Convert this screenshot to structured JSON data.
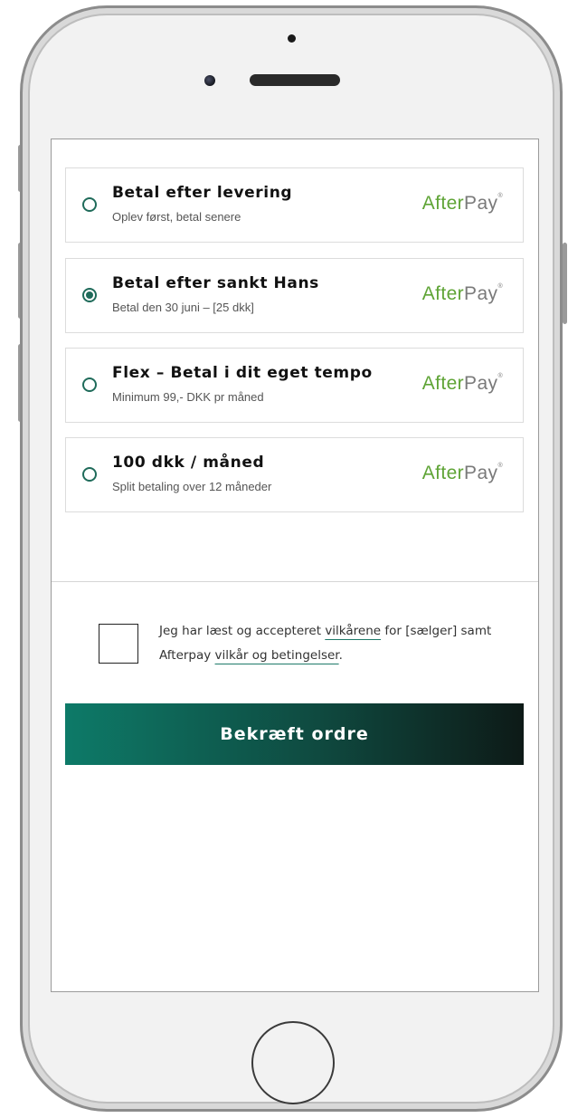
{
  "options": [
    {
      "title": "Betal efter levering",
      "subtitle": "Oplev først, betal senere",
      "selected": false,
      "logo": {
        "part1": "After",
        "part2": "Pay",
        "mark": "®"
      }
    },
    {
      "title": "Betal efter sankt Hans",
      "subtitle": "Betal den 30 juni – [25 dkk]",
      "selected": true,
      "logo": {
        "part1": "After",
        "part2": "Pay",
        "mark": "®"
      }
    },
    {
      "title": "Flex – Betal i dit eget tempo",
      "subtitle": "Minimum 99,- DKK pr måned",
      "selected": false,
      "logo": {
        "part1": "After",
        "part2": "Pay",
        "mark": "®"
      }
    },
    {
      "title": "100 dkk / måned",
      "subtitle": "Split betaling over 12 måneder",
      "selected": false,
      "logo": {
        "part1": "After",
        "part2": "Pay",
        "mark": "®"
      }
    }
  ],
  "terms": {
    "text1": "Jeg har læst og accepteret ",
    "link1": "vilkårene",
    "text2": " for [sælger] samt Afterpay ",
    "link2": "vilkår og betingelser",
    "text3": ".",
    "checked": false
  },
  "confirm_label": "Bekræft ordre",
  "colors": {
    "accent": "#1f6b5a",
    "logo_green": "#5fa436",
    "logo_gray": "#7a7a7a",
    "button_start": "#0d7a68",
    "button_end": "#0d1a17"
  },
  "icons": {
    "radio_unselected": "radio-empty-circle",
    "radio_selected": "radio-filled-circle",
    "home": "home-button-circle"
  }
}
